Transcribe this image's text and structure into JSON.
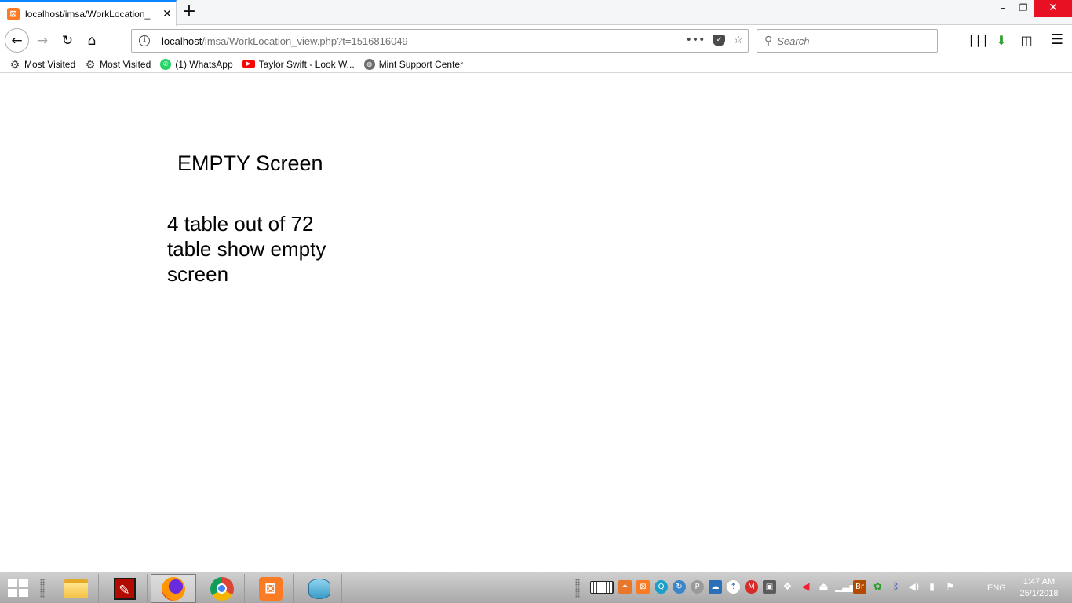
{
  "browser": {
    "tab": {
      "title": "localhost/imsa/WorkLocation_",
      "close": "✕"
    },
    "new_tab": "+",
    "window": {
      "minimize": "–",
      "restore": "❐",
      "close": "✕"
    },
    "url": {
      "host": "localhost",
      "path": "/imsa/WorkLocation_view.php?t=1516816049"
    },
    "url_actions": {
      "more": "•••",
      "bookmark_star": "☆"
    },
    "search": {
      "placeholder": "Search"
    },
    "bookmarks": [
      {
        "label": "Most Visited",
        "icon": "gear-icon"
      },
      {
        "label": "Most Visited",
        "icon": "gear-icon"
      },
      {
        "label": "(1) WhatsApp",
        "icon": "whatsapp-icon"
      },
      {
        "label": "Taylor Swift - Look W...",
        "icon": "youtube-icon"
      },
      {
        "label": "Mint Support Center",
        "icon": "globe-icon"
      }
    ]
  },
  "page": {
    "heading": "EMPTY Screen",
    "note": "4 table out of 72 table show empty screen"
  },
  "taskbar": {
    "apps": [
      "file-explorer",
      "acrobat",
      "firefox",
      "chrome",
      "xampp",
      "database-tool"
    ],
    "active_app": "firefox",
    "language": "ENG",
    "time": "1:47 AM",
    "date": "25/1/2018"
  },
  "colors": {
    "tab_accent": "#0a84ff",
    "close_button": "#e81123",
    "xampp_orange": "#fb7a24"
  }
}
